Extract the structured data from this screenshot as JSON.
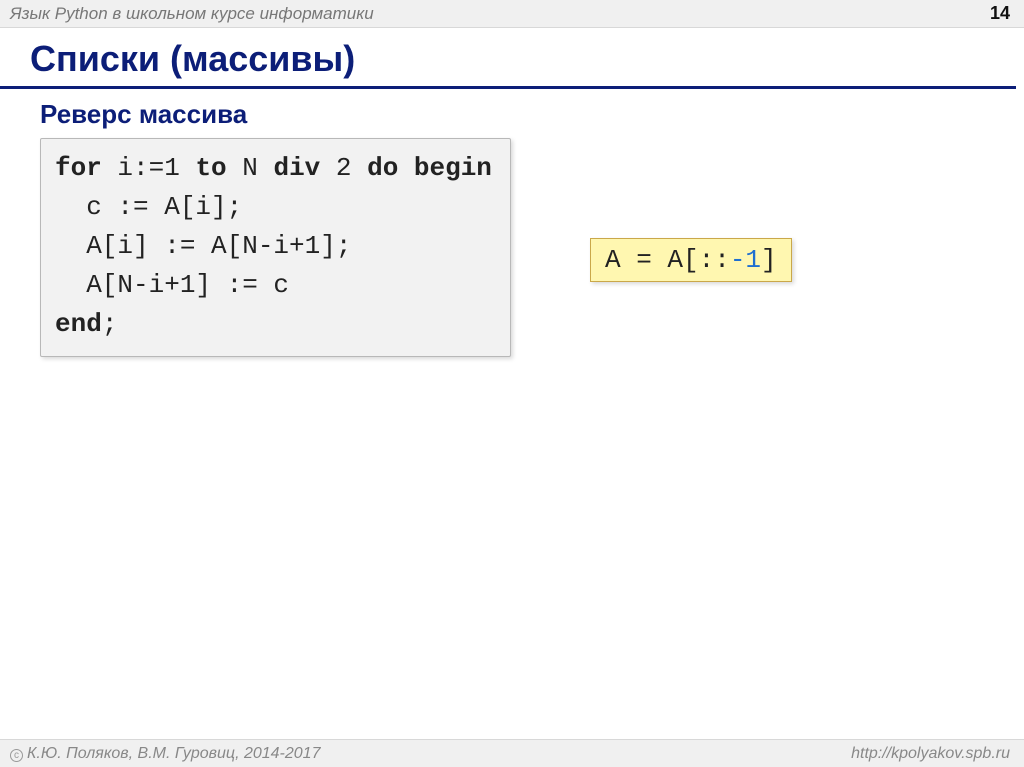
{
  "header": {
    "meta": "Язык Python в школьном курсе информатики",
    "page": "14"
  },
  "title": "Списки (массивы)",
  "subtitle": "Реверс массива",
  "code_pascal": {
    "l1a": "for",
    "l1b": " i:=1 ",
    "l1c": "to",
    "l1d": " N ",
    "l1e": "div",
    "l1f": " 2 ",
    "l1g": "do begin",
    "l2": "  c := A[i];",
    "l3": "  A[i] := A[N-i+1];",
    "l4": "  A[N-i+1] := c",
    "l5": "end",
    "l5b": ";"
  },
  "code_python": {
    "pre": "A = A[::",
    "neg": "-1",
    "post": "]"
  },
  "footer": {
    "authors": "К.Ю. Поляков, В.М. Гуровиц, 2014-2017",
    "url": "http://kpolyakov.spb.ru"
  }
}
